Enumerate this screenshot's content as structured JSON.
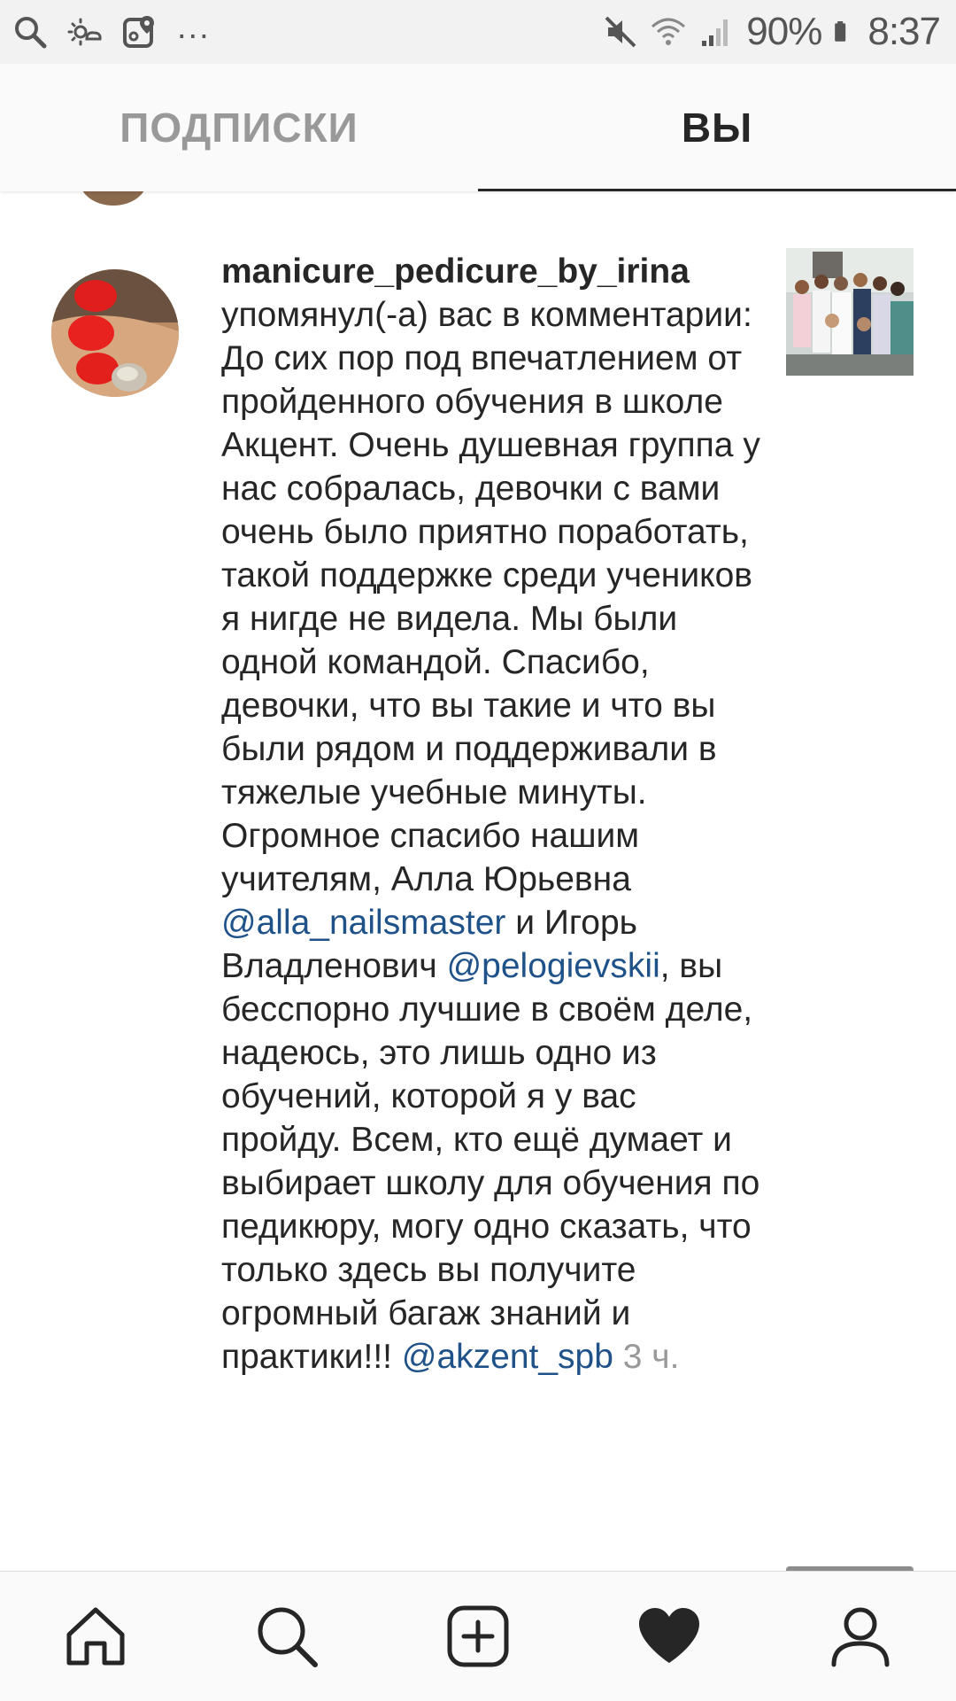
{
  "status_bar": {
    "icons_left": [
      "search-icon",
      "weather-icon",
      "maps-icon"
    ],
    "overflow": "...",
    "icons_right": [
      "mute-icon",
      "wifi-icon",
      "signal-icon",
      "battery-icon"
    ],
    "battery": "90%",
    "time": "8:37"
  },
  "tabs": {
    "following": "ПОДПИСКИ",
    "you": "ВЫ",
    "active": "you"
  },
  "notification": {
    "username": "manicure_pedicure_by_irina",
    "text_1": "упомянул(-а) вас в комментарии: До сих пор под впечатлением от пройденного обучения в школе Акцент. Очень душевная группа у нас собралась, девочки с вами очень было приятно поработать, такой поддержке среди учеников я нигде не видела. Мы были одной командой. Спасибо, девочки, что вы такие и что вы были рядом и поддерживали в тяжелые учебные минуты. Огромное спасибо нашим учителям, Алла Юрьевна",
    "mention_1": "@alla_nailsmaster",
    "text_2": "и Игорь Владленович",
    "mention_2": "@pelogievskii",
    "text_3": ", вы бесспорно лучшие в своём деле, надеюсь, это лишь одно из обучений, которой я у вас пройду. Всем, кто ещё думает и выбирает школу для обучения по педикюру, могу одно сказать, что только здесь вы получите огромный багаж знаний и практики!!!",
    "mention_3": "@akzent_spb",
    "time": "3 ч."
  },
  "bottom_nav": {
    "items": [
      "home-icon",
      "search-icon",
      "add-post-icon",
      "activity-heart-icon",
      "profile-icon"
    ],
    "active": "activity-heart-icon"
  },
  "colors": {
    "mention": "#1f5289",
    "primary_text": "#262626",
    "muted_text": "#999999",
    "status_bar_bg": "#f2f2f2",
    "bars_bg": "#fafafa"
  }
}
